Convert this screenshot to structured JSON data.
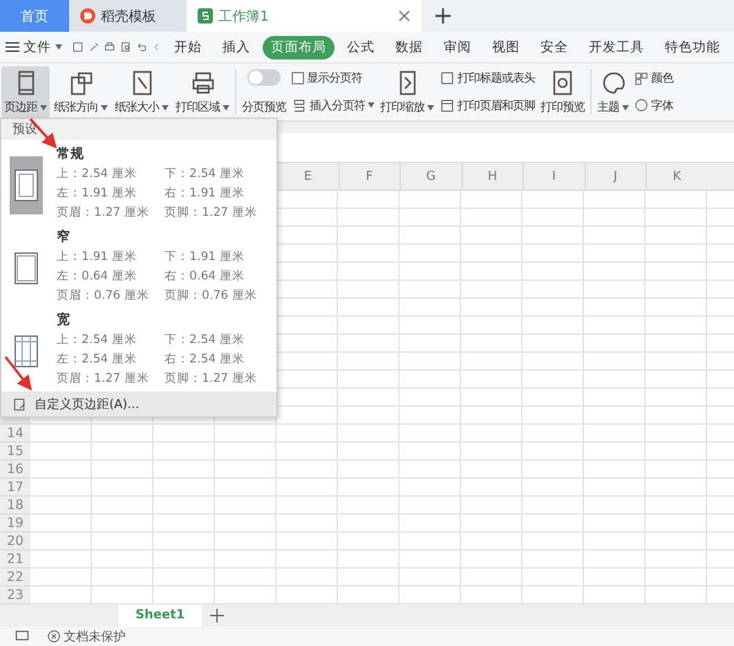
{
  "tabs": [
    {
      "label": "首页",
      "kind": "home",
      "selected": false
    },
    {
      "label": "稻壳模板",
      "kind": "docer",
      "selected": false
    },
    {
      "label": "工作簿1",
      "kind": "sheet",
      "selected": true
    }
  ],
  "menu": {
    "file": "文件",
    "tabs": [
      {
        "label": "开始",
        "selected": false
      },
      {
        "label": "插入",
        "selected": false
      },
      {
        "label": "页面布局",
        "selected": true
      },
      {
        "label": "公式",
        "selected": false
      },
      {
        "label": "数据",
        "selected": false
      },
      {
        "label": "审阅",
        "selected": false
      },
      {
        "label": "视图",
        "selected": false
      },
      {
        "label": "安全",
        "selected": false
      },
      {
        "label": "开发工具",
        "selected": false
      },
      {
        "label": "特色功能",
        "selected": false
      }
    ]
  },
  "ribbon": {
    "large": [
      {
        "label": "页边距",
        "kind": "margins",
        "dropdown": true,
        "selected": true
      },
      {
        "label": "纸张方向",
        "kind": "orientation",
        "dropdown": true,
        "selected": false
      },
      {
        "label": "纸张大小",
        "kind": "size",
        "dropdown": true,
        "selected": false
      },
      {
        "label": "打印区域",
        "kind": "printarea",
        "dropdown": true,
        "selected": false
      }
    ],
    "page_break_preview": {
      "label": "分页预览",
      "on": false
    },
    "show_breaks": {
      "label": "显示分页符",
      "checked": false
    },
    "insert_break": {
      "label": "插入分页符",
      "dropdown": true
    },
    "print_scale": {
      "label": "打印缩放",
      "dropdown": true
    },
    "print_titles": "打印标题或表头",
    "print_header_footer": "打印页眉和页脚",
    "print_preview": "打印预览",
    "theme": {
      "label": "主题",
      "dropdown": true
    },
    "colors": "颜色",
    "fonts": "字体"
  },
  "margins_menu": {
    "heading": "预设",
    "presets": [
      {
        "name": "常规",
        "kind": "normal",
        "selected": true,
        "values": [
          "上：2.54 厘米",
          "下：2.54 厘米",
          "左：1.91 厘米",
          "右：1.91 厘米",
          "页眉：1.27 厘米",
          "页脚：1.27 厘米"
        ]
      },
      {
        "name": "窄",
        "kind": "narrow",
        "selected": false,
        "values": [
          "上：1.91 厘米",
          "下：1.91 厘米",
          "左：0.64 厘米",
          "右：0.64 厘米",
          "页眉：0.76 厘米",
          "页脚：0.76 厘米"
        ]
      },
      {
        "name": "宽",
        "kind": "wide",
        "selected": false,
        "values": [
          "上：2.54 厘米",
          "下：2.54 厘米",
          "左：2.54 厘米",
          "右：2.54 厘米",
          "页眉：1.27 厘米",
          "页脚：1.27 厘米"
        ]
      }
    ],
    "custom": "自定义页边距(A)..."
  },
  "grid": {
    "columns": [
      "E",
      "F",
      "G",
      "H",
      "I",
      "J",
      "K"
    ],
    "rows": [
      "14",
      "15",
      "16",
      "17",
      "18",
      "19",
      "20",
      "21",
      "22",
      "23"
    ]
  },
  "sheets": [
    {
      "label": "Sheet1",
      "selected": true
    }
  ],
  "status_bar": {
    "protection": "文档未保护"
  }
}
